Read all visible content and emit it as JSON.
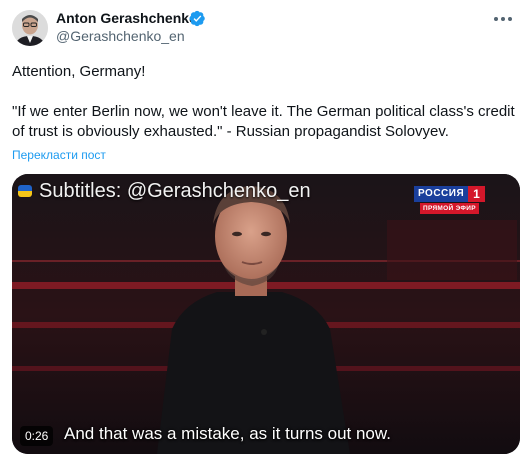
{
  "tweet": {
    "author_name": "Anton Gerashchenko",
    "handle": "@Gerashchenko_en",
    "text_lines": [
      "Attention, Germany!",
      "\"If we enter Berlin now, we won't leave it. The German political class's credit",
      "of trust is obviously exhausted.\" - Russian propagandist Solovyev."
    ],
    "translate_label": "Перекласти пост"
  },
  "icons": {
    "verified": "verified-badge-icon",
    "more": "more-options-icon",
    "flag": "ukraine-flag-icon"
  },
  "media": {
    "caption_overlay": "Subtitles: @Gerashchenko_en",
    "channel_name": "РОССИЯ",
    "channel_number": "1",
    "channel_live": "ПРЯМОЙ ЭФИР",
    "subtitle": "And that was a mistake, as it turns out now.",
    "duration": "0:26"
  },
  "colors": {
    "link_blue": "#1d9bf0",
    "verified_blue": "#1d9bf0",
    "secondary_text": "#536471",
    "primary_text": "#0f1419",
    "studio_red": "#d4172a"
  }
}
